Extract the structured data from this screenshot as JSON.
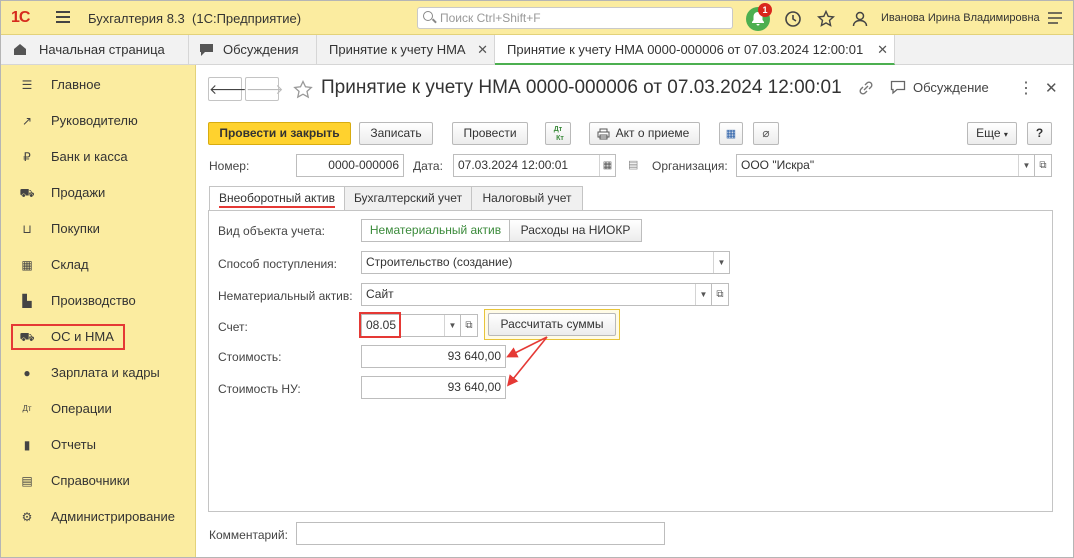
{
  "app": {
    "logo": "1С",
    "title": "Бухгалтерия 8.3",
    "subtitle": "(1С:Предприятие)",
    "search_placeholder": "Поиск Ctrl+Shift+F",
    "notifications_count": "1",
    "user": "Иванова Ирина Владимировна"
  },
  "tabs": [
    {
      "label": "Начальная страница"
    },
    {
      "label": "Обсуждения"
    },
    {
      "label": "Принятие к учету НМА"
    },
    {
      "label": "Принятие к учету НМА 0000-000006 от 07.03.2024 12:00:01"
    }
  ],
  "sidebar": {
    "items": [
      {
        "label": "Главное",
        "icon": "menu-icon"
      },
      {
        "label": "Руководителю",
        "icon": "trend-icon"
      },
      {
        "label": "Банк и касса",
        "icon": "ruble-icon"
      },
      {
        "label": "Продажи",
        "icon": "cart-icon"
      },
      {
        "label": "Покупки",
        "icon": "basket-icon"
      },
      {
        "label": "Склад",
        "icon": "warehouse-icon"
      },
      {
        "label": "Производство",
        "icon": "factory-icon"
      },
      {
        "label": "ОС и НМА",
        "icon": "truck-icon"
      },
      {
        "label": "Зарплата и кадры",
        "icon": "person-icon"
      },
      {
        "label": "Операции",
        "icon": "dt-kt-icon"
      },
      {
        "label": "Отчеты",
        "icon": "bar-chart-icon"
      },
      {
        "label": "Справочники",
        "icon": "book-icon"
      },
      {
        "label": "Администрирование",
        "icon": "gear-icon"
      }
    ]
  },
  "document": {
    "title": "Принятие к учету НМА 0000-000006 от 07.03.2024 12:00:01",
    "discussion_label": "Обсуждение"
  },
  "toolbar": {
    "post_close": "Провести и закрыть",
    "save": "Записать",
    "post": "Провести",
    "act": "Акт о приеме",
    "more": "Еще",
    "help": "?"
  },
  "header_fields": {
    "number_label": "Номер:",
    "number_value": "0000-000006",
    "date_label": "Дата:",
    "date_value": "07.03.2024 12:00:01",
    "org_label": "Организация:",
    "org_value": "ООО \"Искра\""
  },
  "form_tabs": [
    {
      "label": "Внеоборотный актив"
    },
    {
      "label": "Бухгалтерский учет"
    },
    {
      "label": "Налоговый учет"
    }
  ],
  "form": {
    "object_type_label": "Вид объекта учета:",
    "object_type_options": [
      "Нематериальный актив",
      "Расходы на НИОКР"
    ],
    "receipt_method_label": "Способ поступления:",
    "receipt_method_value": "Строительство (создание)",
    "intangible_label": "Нематериальный актив:",
    "intangible_value": "Сайт",
    "account_label": "Счет:",
    "account_value": "08.05",
    "calc_button": "Рассчитать суммы",
    "cost_label": "Стоимость:",
    "cost_value": "93 640,00",
    "tax_cost_label": "Стоимость НУ:",
    "tax_cost_value": "93 640,00",
    "comment_label": "Комментарий:",
    "comment_value": ""
  },
  "colors": {
    "sidebar_bg": "#fbeca0",
    "accent_green": "#4caf50",
    "primary_button": "#ffd22e",
    "highlight_red": "#e53935"
  }
}
